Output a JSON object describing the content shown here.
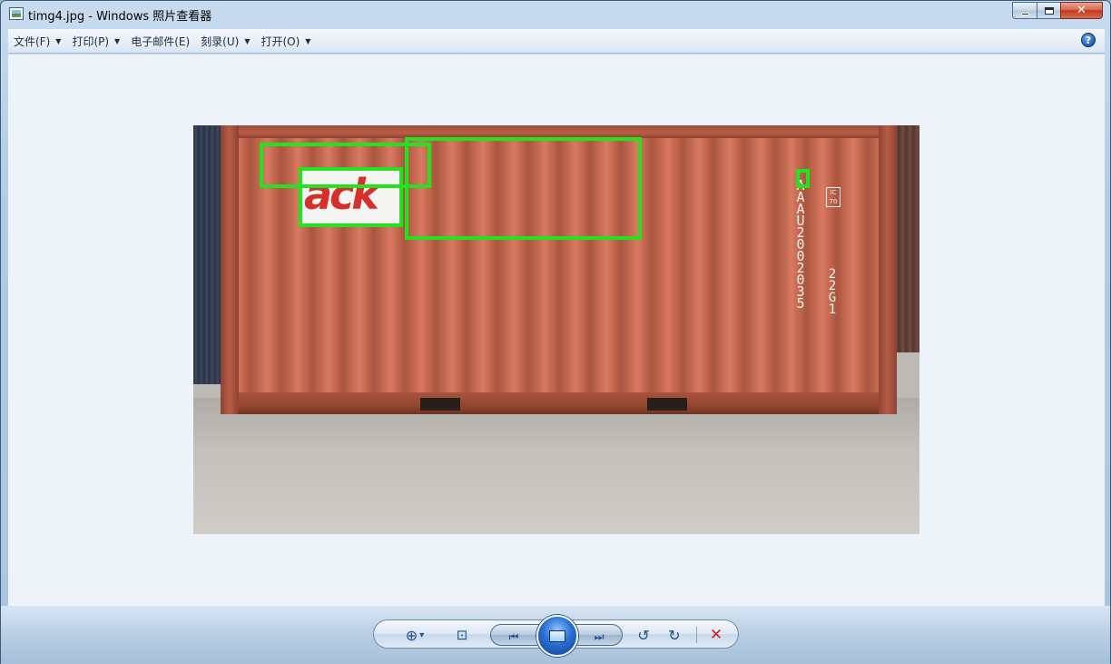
{
  "window": {
    "title": "timg4.jpg - Windows 照片查看器",
    "minimize_icon": "minimize-icon",
    "maximize_icon": "maximize-icon",
    "close_icon": "close-icon",
    "close_glyph": "✕"
  },
  "menu": {
    "items": [
      {
        "label": "文件(F)",
        "has_dropdown": true
      },
      {
        "label": "打印(P)",
        "has_dropdown": true
      },
      {
        "label": "电子邮件(E)",
        "has_dropdown": false
      },
      {
        "label": "刻录(U)",
        "has_dropdown": true
      },
      {
        "label": "打开(O)",
        "has_dropdown": true
      }
    ],
    "dropdown_glyph": "▼",
    "help_glyph": "?"
  },
  "photo": {
    "logo_text": "ack",
    "container_code": "AAAU2002035",
    "container_type": "22G1",
    "ic_badge": "IC 70",
    "detection_color": "#22e41e"
  },
  "controls": {
    "zoom_glyph": "⊕",
    "zoom_arrow": "▾",
    "fit_glyph": "⊡",
    "prev_glyph": "⏮",
    "next_glyph": "⏭",
    "rotate_ccw_glyph": "↺",
    "rotate_cw_glyph": "↻",
    "delete_glyph": "✕"
  }
}
